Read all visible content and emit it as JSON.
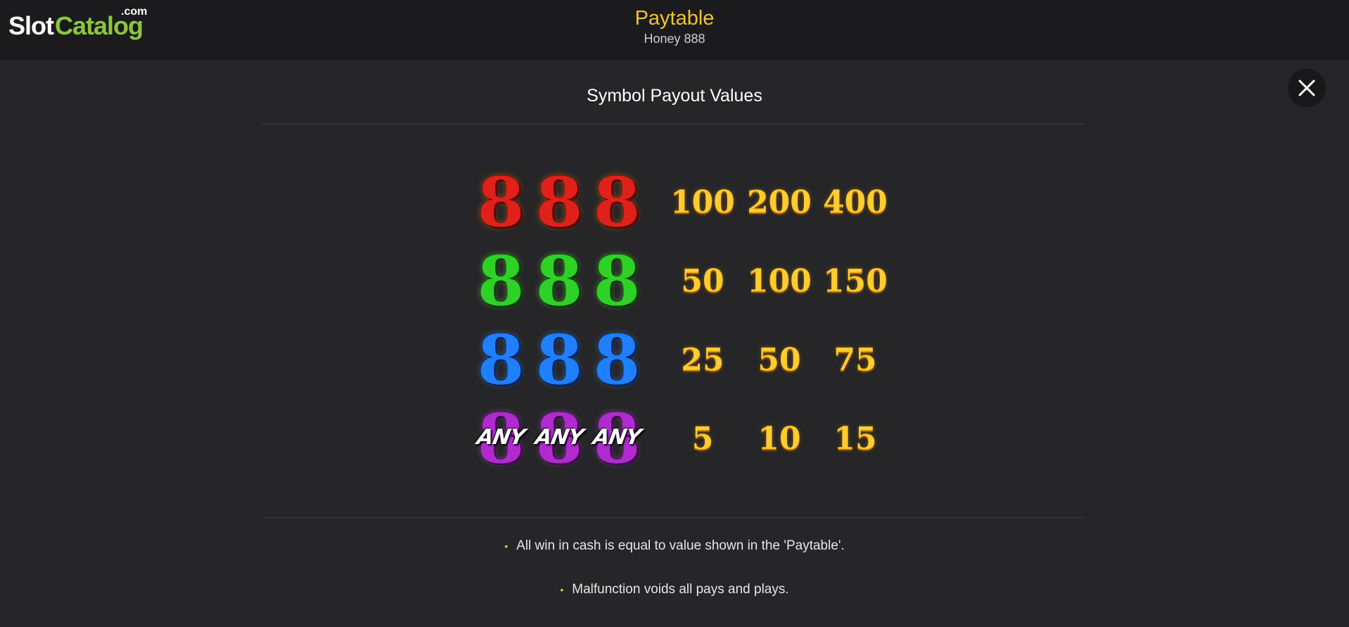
{
  "header": {
    "logo": {
      "slot": "Slot",
      "catalog": "Catalog",
      "com": ".com"
    },
    "title": "Paytable",
    "subtitle": "Honey 888"
  },
  "close_icon": "close-icon",
  "section_title": "Symbol Payout Values",
  "paytable": {
    "rows": [
      {
        "symbol": "8",
        "color": "#e0201a",
        "any": "",
        "payouts": [
          "100",
          "200",
          "400"
        ]
      },
      {
        "symbol": "8",
        "color": "#2ed126",
        "any": "",
        "payouts": [
          "50",
          "100",
          "150"
        ]
      },
      {
        "symbol": "8",
        "color": "#1e7fff",
        "any": "",
        "payouts": [
          "25",
          "50",
          "75"
        ]
      },
      {
        "symbol": "8",
        "color": "#b02ad0",
        "any": "ANY",
        "payouts": [
          "5",
          "10",
          "15"
        ]
      }
    ]
  },
  "notes": [
    "All win in cash is equal to value shown in the 'Paytable'.",
    "Malfunction voids all pays and plays."
  ],
  "colors": {
    "accent": "#f2c230",
    "brand_green": "#8cc63f",
    "payout_gold": "#ffcc2e"
  }
}
